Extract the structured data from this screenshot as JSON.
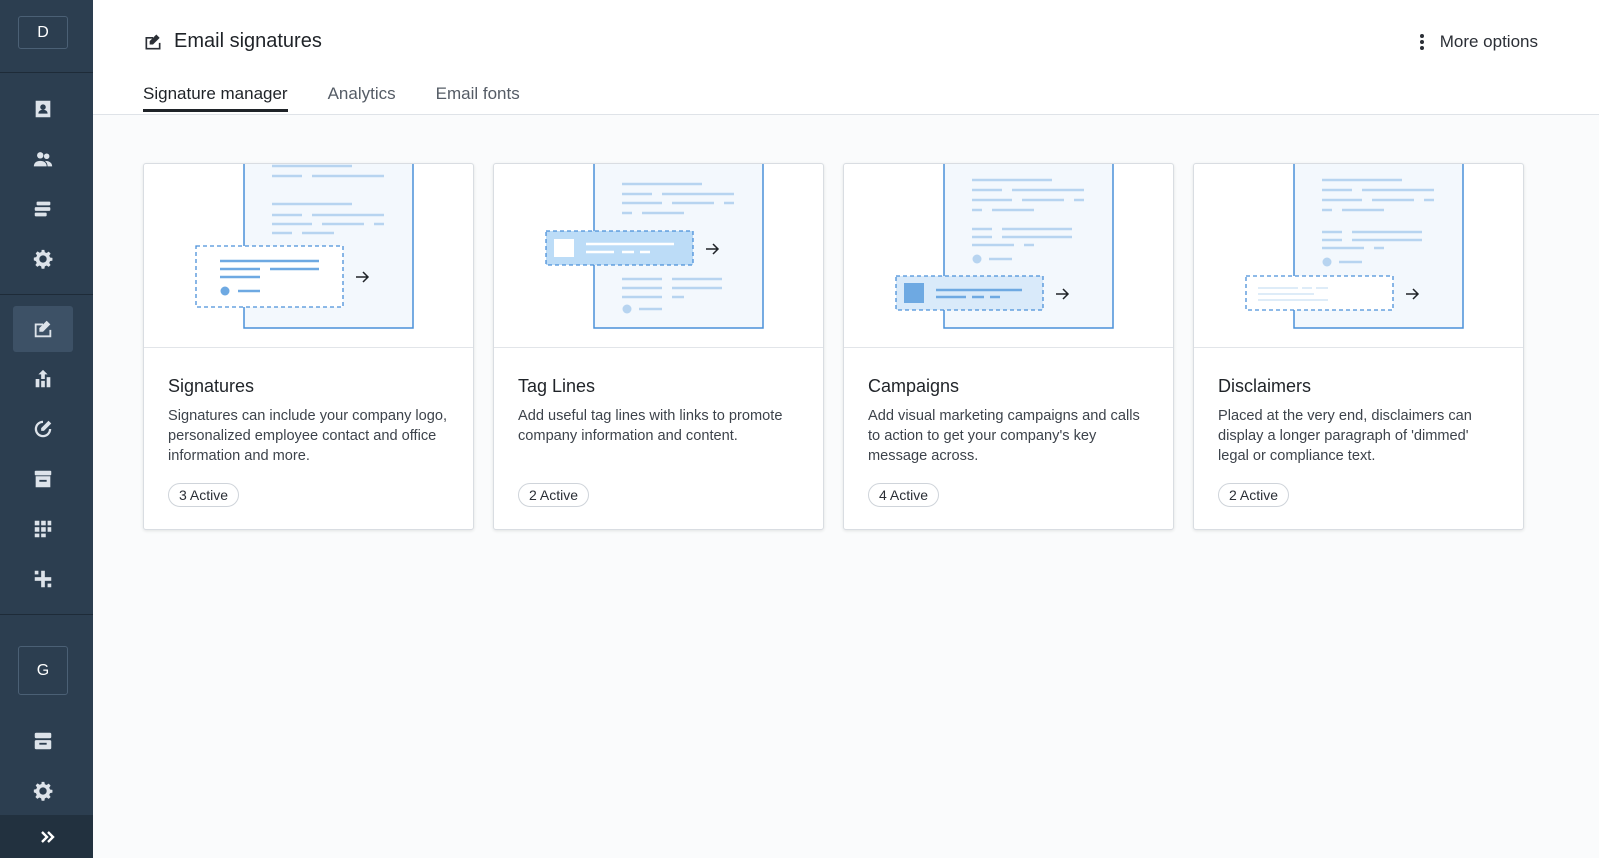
{
  "sidebar": {
    "top_badge": "D",
    "bottom_badge": "G",
    "icons": [
      "contact-card-icon",
      "users-icon",
      "stack-icon",
      "gear-icon",
      "signature-icon",
      "upload-chart-icon",
      "edit-circle-icon",
      "archive-box-icon",
      "grid-icon",
      "plus-network-icon",
      "archive-icon",
      "settings-icon"
    ],
    "expand_icon": "double-chevron-right-icon"
  },
  "header": {
    "title": "Email signatures",
    "more_options": "More options",
    "tabs": [
      {
        "label": "Signature manager",
        "active": true
      },
      {
        "label": "Analytics",
        "active": false
      },
      {
        "label": "Email fonts",
        "active": false
      }
    ]
  },
  "cards": [
    {
      "title": "Signatures",
      "description": "Signatures can include your company logo, personalized employee contact and office information and more.",
      "badge": "3 Active"
    },
    {
      "title": "Tag Lines",
      "description": "Add useful tag lines with links to promote company information and content.",
      "badge": "2 Active"
    },
    {
      "title": "Campaigns",
      "description": "Add visual marketing campaigns and calls to action to get your company's key message across.",
      "badge": "4 Active"
    },
    {
      "title": "Disclaimers",
      "description": "Placed at the very end, disclaimers can display a longer paragraph of 'dimmed' legal or compliance text.",
      "badge": "2 Active"
    }
  ],
  "colors": {
    "sidebar": "#2c3e50",
    "accent_blue": "#4a90d9",
    "light_blue": "#bcdcf7"
  }
}
